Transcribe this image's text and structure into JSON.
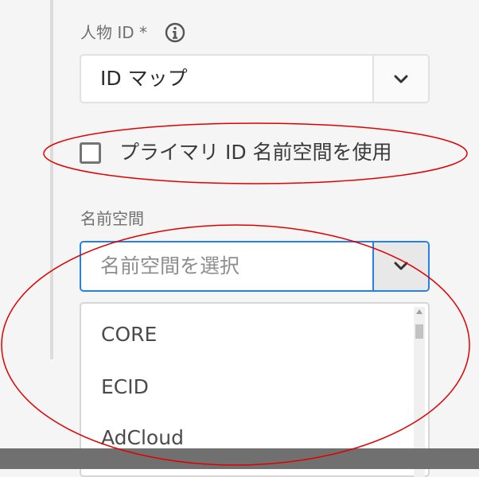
{
  "person_id": {
    "label": "人物 ID *",
    "info_icon": "info-icon",
    "value": "ID マップ",
    "dropdown_icon": "chevron-down-icon"
  },
  "primary_namespace": {
    "checkbox_label": "プライマリ ID 名前空間を使用",
    "checked": false
  },
  "namespace": {
    "label": "名前空間",
    "placeholder": "名前空間を選択",
    "dropdown_icon": "chevron-down-icon",
    "options": [
      "CORE",
      "ECID",
      "AdCloud"
    ]
  },
  "annotation_color": "#e00000"
}
